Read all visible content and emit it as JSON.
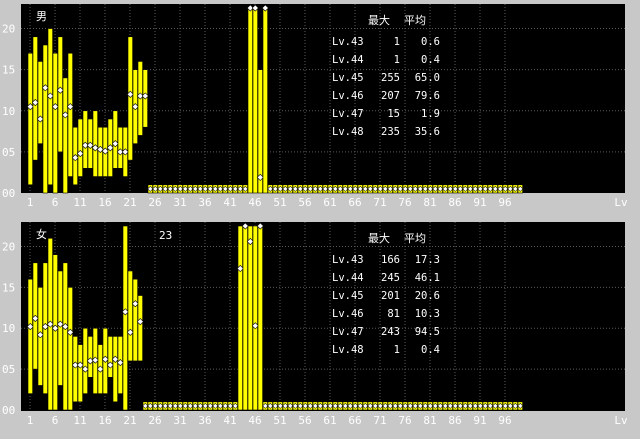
{
  "chart_data": [
    {
      "type": "bar",
      "group_label": "男",
      "annotation": "",
      "table_headers": [
        "最大",
        "平均"
      ],
      "table_rows": [
        {
          "level": "Lv.43",
          "max": "1",
          "avg": "0.6"
        },
        {
          "level": "Lv.44",
          "max": "1",
          "avg": "0.4"
        },
        {
          "level": "Lv.45",
          "max": "255",
          "avg": "65.0"
        },
        {
          "level": "Lv.46",
          "max": "207",
          "avg": "79.6"
        },
        {
          "level": "Lv.47",
          "max": "15",
          "avg": "1.9"
        },
        {
          "level": "Lv.48",
          "max": "235",
          "avg": "35.6"
        }
      ],
      "x_ticks": [
        "1",
        "6",
        "11",
        "16",
        "21",
        "26",
        "31",
        "36",
        "41",
        "46",
        "51",
        "56",
        "61",
        "66",
        "71",
        "76",
        "81",
        "86",
        "91",
        "96",
        "Lv"
      ],
      "y_ticks": [
        "00",
        "05",
        "10",
        "15",
        "20"
      ],
      "ylim": [
        0,
        22.5
      ],
      "bars": [
        {
          "lv": 1,
          "min": 1,
          "max": 17,
          "avg": 10.5
        },
        {
          "lv": 2,
          "min": 4,
          "max": 19,
          "avg": 11
        },
        {
          "lv": 3,
          "min": 6,
          "max": 16,
          "avg": 9
        },
        {
          "lv": 4,
          "min": 0,
          "max": 18,
          "avg": 12.8
        },
        {
          "lv": 5,
          "min": 1,
          "max": 20,
          "avg": 11.8
        },
        {
          "lv": 6,
          "min": 0,
          "max": 17,
          "avg": 10.5
        },
        {
          "lv": 7,
          "min": 5,
          "max": 19,
          "avg": 12.5
        },
        {
          "lv": 8,
          "min": 0,
          "max": 14,
          "avg": 9.5
        },
        {
          "lv": 9,
          "min": 2,
          "max": 17,
          "avg": 10.5
        },
        {
          "lv": 10,
          "min": 1,
          "max": 8,
          "avg": 4.3
        },
        {
          "lv": 11,
          "min": 2,
          "max": 9,
          "avg": 4.8
        },
        {
          "lv": 12,
          "min": 3,
          "max": 10,
          "avg": 5.8
        },
        {
          "lv": 13,
          "min": 3,
          "max": 9,
          "avg": 5.8
        },
        {
          "lv": 14,
          "min": 2,
          "max": 10,
          "avg": 5.5
        },
        {
          "lv": 15,
          "min": 2,
          "max": 8,
          "avg": 5.3
        },
        {
          "lv": 16,
          "min": 2,
          "max": 8,
          "avg": 5.1
        },
        {
          "lv": 17,
          "min": 2,
          "max": 9,
          "avg": 5.5
        },
        {
          "lv": 18,
          "min": 3,
          "max": 10,
          "avg": 6
        },
        {
          "lv": 19,
          "min": 3,
          "max": 8,
          "avg": 5
        },
        {
          "lv": 20,
          "min": 2,
          "max": 8,
          "avg": 5
        },
        {
          "lv": 21,
          "min": 4,
          "max": 19,
          "avg": 12
        },
        {
          "lv": 22,
          "min": 6,
          "max": 15,
          "avg": 10.5
        },
        {
          "lv": 23,
          "min": 7,
          "max": 16,
          "avg": 11.8
        },
        {
          "lv": 24,
          "min": 8,
          "max": 15,
          "avg": 11.8
        },
        {
          "lv": 45,
          "min": 0,
          "max": 255,
          "avg": 65.0
        },
        {
          "lv": 46,
          "min": 0,
          "max": 207,
          "avg": 79.6
        },
        {
          "lv": 47,
          "min": 0,
          "max": 15,
          "avg": 1.9
        },
        {
          "lv": 48,
          "min": 0,
          "max": 235,
          "avg": 35.6
        }
      ],
      "low_min_lvs": [
        43,
        44,
        47
      ],
      "low_band": {
        "from": 25,
        "to": 99,
        "max": 1,
        "avg": 0.5
      }
    },
    {
      "type": "bar",
      "group_label": "女",
      "annotation": "23",
      "table_headers": [
        "最大",
        "平均"
      ],
      "table_rows": [
        {
          "level": "Lv.43",
          "max": "166",
          "avg": "17.3"
        },
        {
          "level": "Lv.44",
          "max": "245",
          "avg": "46.1"
        },
        {
          "level": "Lv.45",
          "max": "201",
          "avg": "20.6"
        },
        {
          "level": "Lv.46",
          "max": "81",
          "avg": "10.3"
        },
        {
          "level": "Lv.47",
          "max": "243",
          "avg": "94.5"
        },
        {
          "level": "Lv.48",
          "max": "1",
          "avg": "0.4"
        }
      ],
      "x_ticks": [
        "1",
        "6",
        "11",
        "16",
        "21",
        "26",
        "31",
        "36",
        "41",
        "46",
        "51",
        "56",
        "61",
        "66",
        "71",
        "76",
        "81",
        "86",
        "91",
        "96",
        "Lv"
      ],
      "y_ticks": [
        "00",
        "05",
        "10",
        "15",
        "20"
      ],
      "ylim": [
        0,
        22.5
      ],
      "bars": [
        {
          "lv": 1,
          "min": 2,
          "max": 16,
          "avg": 10.2
        },
        {
          "lv": 2,
          "min": 5,
          "max": 18,
          "avg": 11.2
        },
        {
          "lv": 3,
          "min": 3,
          "max": 15,
          "avg": 9.2
        },
        {
          "lv": 4,
          "min": 2,
          "max": 18,
          "avg": 10.2
        },
        {
          "lv": 5,
          "min": 0,
          "max": 21,
          "avg": 10.5
        },
        {
          "lv": 6,
          "min": 0,
          "max": 19,
          "avg": 10
        },
        {
          "lv": 7,
          "min": 3,
          "max": 17,
          "avg": 10.5
        },
        {
          "lv": 8,
          "min": 0,
          "max": 18,
          "avg": 10.2
        },
        {
          "lv": 9,
          "min": 0,
          "max": 15,
          "avg": 9.5
        },
        {
          "lv": 10,
          "min": 1,
          "max": 9,
          "avg": 5.5
        },
        {
          "lv": 11,
          "min": 1,
          "max": 8,
          "avg": 5.5
        },
        {
          "lv": 12,
          "min": 2,
          "max": 10,
          "avg": 5
        },
        {
          "lv": 13,
          "min": 4,
          "max": 9,
          "avg": 6
        },
        {
          "lv": 14,
          "min": 2,
          "max": 10,
          "avg": 6.1
        },
        {
          "lv": 15,
          "min": 2,
          "max": 8,
          "avg": 5
        },
        {
          "lv": 16,
          "min": 2,
          "max": 10,
          "avg": 6.2
        },
        {
          "lv": 17,
          "min": 4,
          "max": 9,
          "avg": 5.5
        },
        {
          "lv": 18,
          "min": 1,
          "max": 9,
          "avg": 6.2
        },
        {
          "lv": 19,
          "min": 2,
          "max": 9,
          "avg": 5.8
        },
        {
          "lv": 20,
          "min": 0,
          "max": 23,
          "avg": 12
        },
        {
          "lv": 21,
          "min": 6,
          "max": 17,
          "avg": 9.5
        },
        {
          "lv": 22,
          "min": 6,
          "max": 16,
          "avg": 13
        },
        {
          "lv": 23,
          "min": 6,
          "max": 14,
          "avg": 10.8
        },
        {
          "lv": 43,
          "min": 0,
          "max": 166,
          "avg": 17.3
        },
        {
          "lv": 44,
          "min": 0,
          "max": 245,
          "avg": 46.1
        },
        {
          "lv": 45,
          "min": 0,
          "max": 201,
          "avg": 20.6
        },
        {
          "lv": 46,
          "min": 0,
          "max": 81,
          "avg": 10.3
        },
        {
          "lv": 47,
          "min": 0,
          "max": 243,
          "avg": 94.5
        }
      ],
      "low_min_lvs": [
        48
      ],
      "low_band": {
        "from": 24,
        "to": 99,
        "max": 1,
        "avg": 0.5
      }
    }
  ]
}
